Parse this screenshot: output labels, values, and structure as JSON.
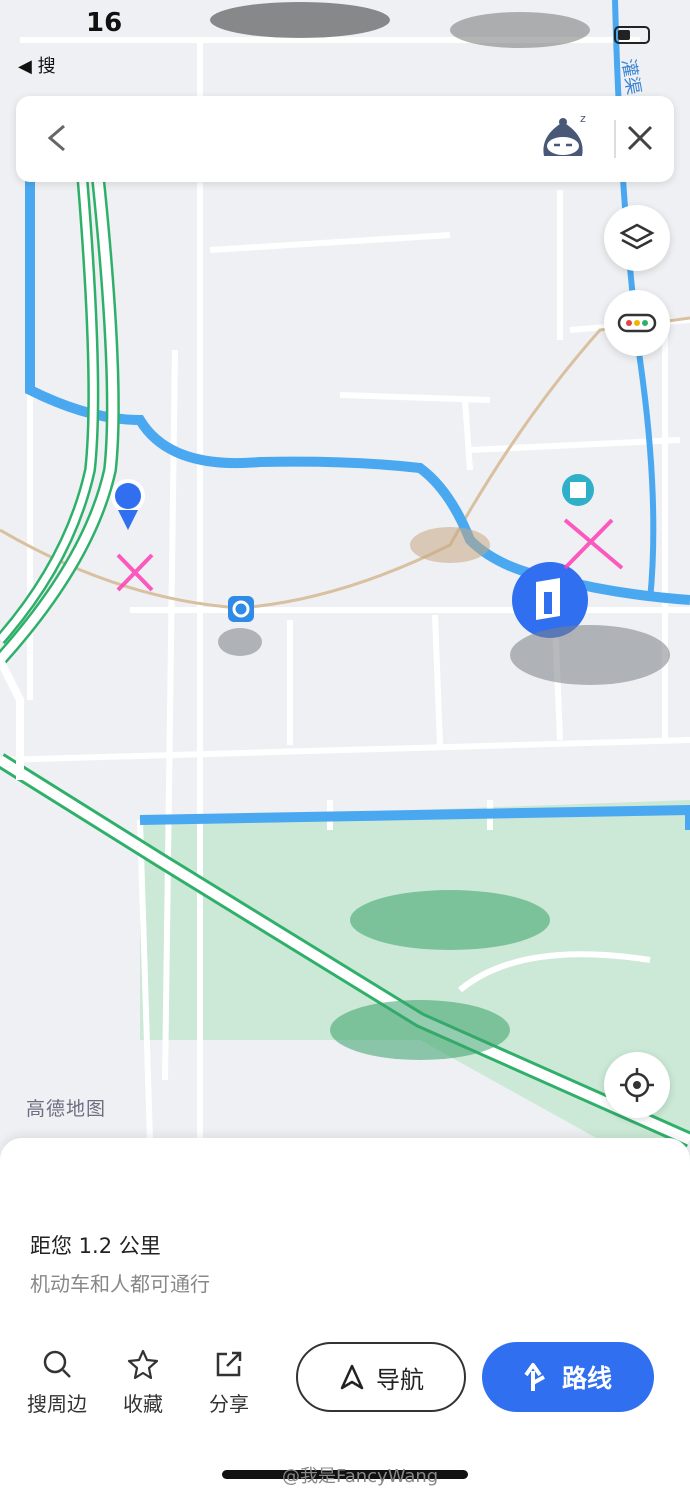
{
  "status_bar": {
    "time": "16",
    "back_app": "◀ 搜"
  },
  "map": {
    "brand": "高德地图",
    "canal_label": "灌渠",
    "colors": {
      "water": "#4aa8f0",
      "park": "#cbe9d6",
      "highway": "#2fb06a",
      "road": "#ffffff",
      "accent": "#2f6ff0",
      "background": "#eef0f3"
    }
  },
  "top_bar": {
    "back_icon": "chevron-left-icon",
    "avatar_icon": "sleepy-assistant-icon",
    "close_icon": "close-icon"
  },
  "side_controls": {
    "layers_icon": "layers-icon",
    "traffic_icon": "traffic-icon",
    "locate_icon": "locate-icon"
  },
  "poi_sheet": {
    "distance": "距您 1.2 公里",
    "passable": "机动车和人都可通行",
    "actions": [
      {
        "label": "搜周边",
        "icon": "search-icon"
      },
      {
        "label": "收藏",
        "icon": "star-icon"
      },
      {
        "label": "分享",
        "icon": "share-icon"
      }
    ],
    "nav_button": "导航",
    "route_button": "路线"
  },
  "watermark": "@我是FancyWang"
}
